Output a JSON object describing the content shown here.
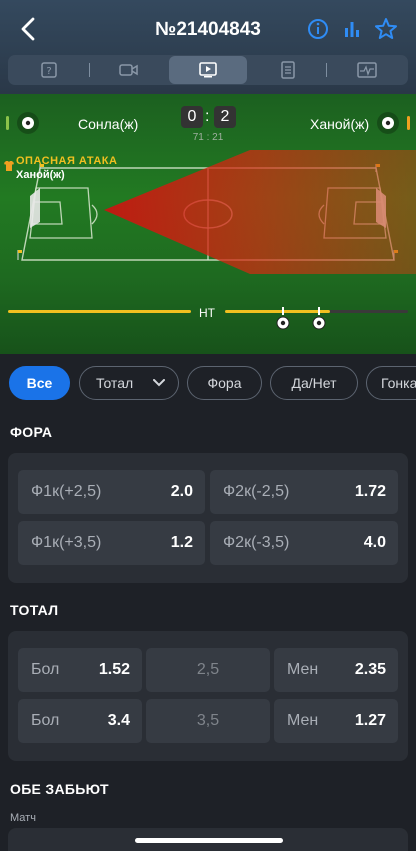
{
  "header": {
    "title": "№21404843"
  },
  "tabs": [
    "info",
    "video",
    "broadcast",
    "scoreboard",
    "stats"
  ],
  "match": {
    "home_team": "Сонла(ж)",
    "away_team": "Ханой(ж)",
    "score_home": "0",
    "score_away": "2",
    "score_sep": ":",
    "time": "71 : 21",
    "attack_label": "ОПАСНАЯ АТАКА",
    "attack_team": "Ханой(ж)",
    "half_label": "HT",
    "colors": {
      "home_accent": "#8bc34a",
      "away_accent": "#f0a020",
      "progress": "#f0c020"
    }
  },
  "filters": {
    "items": [
      "Все",
      "Тотал",
      "Фора",
      "Да/Нет",
      "Гонка"
    ],
    "active": "Все"
  },
  "fora": {
    "title": "ФОРА",
    "rows": [
      [
        {
          "label": "Ф1к(+2,5)",
          "value": "2.0"
        },
        {
          "label": "Ф2к(-2,5)",
          "value": "1.72"
        }
      ],
      [
        {
          "label": "Ф1к(+3,5)",
          "value": "1.2"
        },
        {
          "label": "Ф2к(-3,5)",
          "value": "4.0"
        }
      ]
    ]
  },
  "total": {
    "title": "ТОТАЛ",
    "rows": [
      {
        "over_label": "Бол",
        "over": "1.52",
        "line": "2,5",
        "under_label": "Мен",
        "under": "2.35"
      },
      {
        "over_label": "Бол",
        "over": "3.4",
        "line": "3,5",
        "under_label": "Мен",
        "under": "1.27"
      }
    ]
  },
  "both_score": {
    "title": "ОБЕ ЗАБЬЮТ",
    "subtitle": "Матч"
  }
}
